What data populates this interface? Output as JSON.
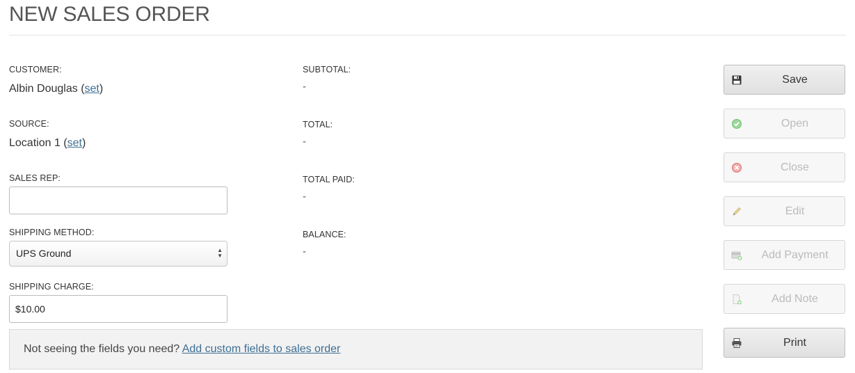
{
  "page": {
    "title": "NEW SALES ORDER"
  },
  "left_fields": {
    "customer": {
      "label": "CUSTOMER:",
      "value": "Albin Douglas",
      "link": "set"
    },
    "source": {
      "label": "SOURCE:",
      "value": "Location 1",
      "link": "set"
    },
    "sales_rep": {
      "label": "SALES REP:",
      "value": ""
    },
    "shipping_method": {
      "label": "SHIPPING METHOD:",
      "selected": "UPS Ground"
    },
    "shipping_charge": {
      "label": "SHIPPING CHARGE:",
      "value": "$10.00"
    }
  },
  "totals": {
    "subtotal": {
      "label": "SUBTOTAL:",
      "value": "-"
    },
    "total": {
      "label": "TOTAL:",
      "value": "-"
    },
    "total_paid": {
      "label": "TOTAL PAID:",
      "value": "-"
    },
    "balance": {
      "label": "BALANCE:",
      "value": "-"
    }
  },
  "custom_fields_note": {
    "text": "Not seeing the fields you need?",
    "link": "Add custom fields to sales order"
  },
  "actions": {
    "save": {
      "label": "Save",
      "enabled": true,
      "icon": "floppy-disk-icon"
    },
    "open": {
      "label": "Open",
      "enabled": false,
      "icon": "check-circle-icon"
    },
    "close": {
      "label": "Close",
      "enabled": false,
      "icon": "x-circle-icon"
    },
    "edit": {
      "label": "Edit",
      "enabled": false,
      "icon": "pencil-icon"
    },
    "add_payment": {
      "label": "Add Payment",
      "enabled": false,
      "icon": "payment-card-icon"
    },
    "add_note": {
      "label": "Add Note",
      "enabled": false,
      "icon": "note-add-icon"
    },
    "print": {
      "label": "Print",
      "enabled": true,
      "icon": "printer-icon"
    }
  },
  "colors": {
    "link": "#3d6f93",
    "open_icon": "#6cc36c",
    "close_icon": "#e07070",
    "disabled_text": "#bbbbbb"
  }
}
